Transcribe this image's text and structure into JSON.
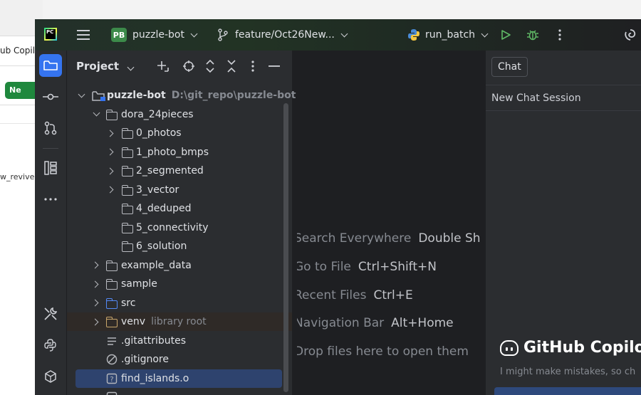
{
  "background_window": {
    "tab_text": "ub Copil",
    "new_button_label": "Ne",
    "side_text": "w_revive"
  },
  "titlebar": {
    "project_badge": "PB",
    "project_name": "puzzle-bot",
    "branch": "feature/Oct26New...",
    "run_config": "run_batch"
  },
  "project_panel": {
    "title": "Project",
    "tree": [
      {
        "name": "puzzle-bot",
        "path": "D:\\git_repo\\puzzle-bot",
        "depth": 0,
        "expanded": true,
        "type": "folder"
      },
      {
        "name": "dora_24pieces",
        "depth": 1,
        "expanded": true,
        "type": "folder"
      },
      {
        "name": "0_photos",
        "depth": 2,
        "expandable": true,
        "type": "folder"
      },
      {
        "name": "1_photo_bmps",
        "depth": 2,
        "expandable": true,
        "type": "folder"
      },
      {
        "name": "2_segmented",
        "depth": 2,
        "expandable": true,
        "type": "folder"
      },
      {
        "name": "3_vector",
        "depth": 2,
        "expandable": true,
        "type": "folder"
      },
      {
        "name": "4_deduped",
        "depth": 2,
        "expandable": false,
        "type": "folder"
      },
      {
        "name": "5_connectivity",
        "depth": 2,
        "expandable": false,
        "type": "folder"
      },
      {
        "name": "6_solution",
        "depth": 2,
        "expandable": false,
        "type": "folder"
      },
      {
        "name": "example_data",
        "depth": 1,
        "expandable": true,
        "type": "folder"
      },
      {
        "name": "sample",
        "depth": 1,
        "expandable": true,
        "type": "folder"
      },
      {
        "name": "src",
        "depth": 1,
        "expandable": true,
        "type": "folder-blue"
      },
      {
        "name": "venv",
        "suffix": "library root",
        "depth": 1,
        "expandable": true,
        "type": "folder-venv"
      },
      {
        "name": ".gitattributes",
        "depth": 1,
        "type": "file-lines"
      },
      {
        "name": ".gitignore",
        "depth": 1,
        "type": "file-ignore"
      },
      {
        "name": "find_islands.o",
        "depth": 1,
        "type": "file-unknown",
        "selected": true
      }
    ]
  },
  "editor_hints": [
    {
      "label": "Search Everywhere",
      "key": "Double Shi"
    },
    {
      "label": "Go to File",
      "key": "Ctrl+Shift+N"
    },
    {
      "label": "Recent Files",
      "key": "Ctrl+E"
    },
    {
      "label": "Navigation Bar",
      "key": "Alt+Home"
    },
    {
      "label": "Drop files here to open them",
      "key": ""
    }
  ],
  "chat_panel": {
    "tab_label": "Chat",
    "session_title": "New Chat Session",
    "brand": "GitHub Copilot",
    "disclaimer": "I might make mistakes, so ch"
  },
  "colors": {
    "accent": "#3574f0",
    "selection": "#2e436e",
    "panel": "#2b2d30",
    "editor": "#1e1f22"
  }
}
